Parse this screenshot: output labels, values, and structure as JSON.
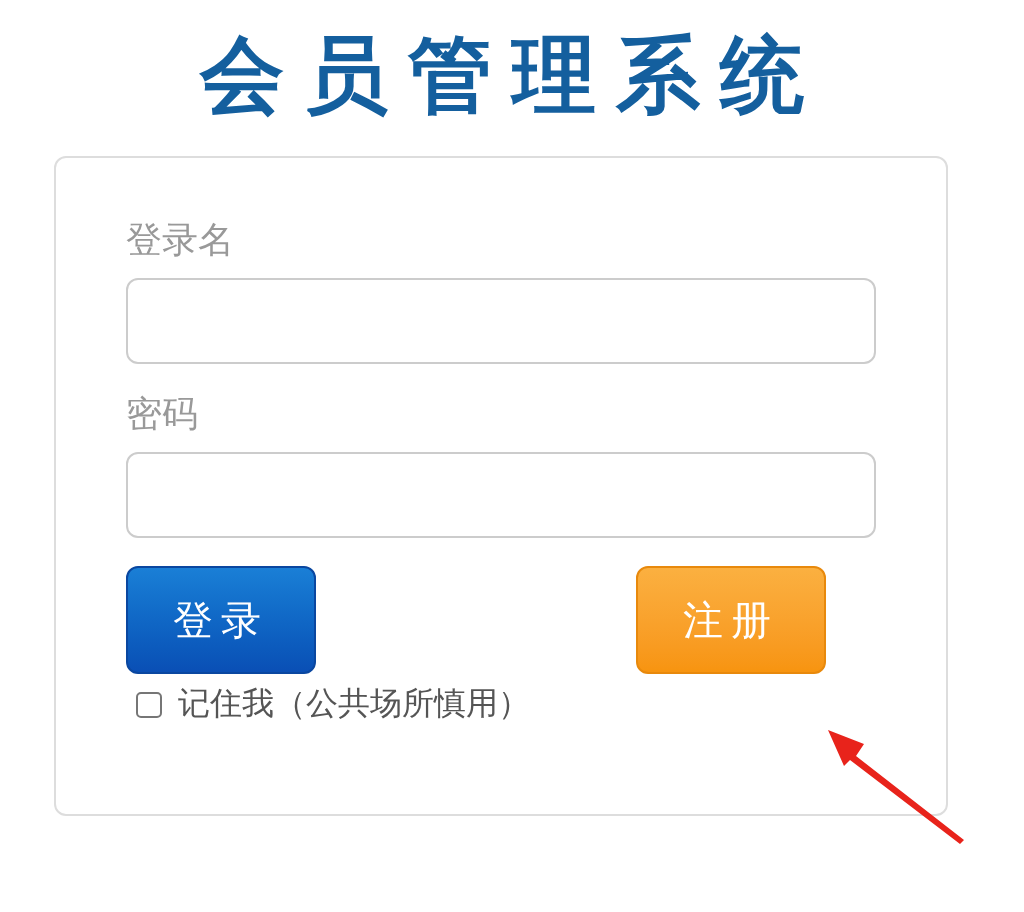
{
  "title": "会员管理系统",
  "fields": [
    {
      "label": "登录名"
    },
    {
      "label": "密码"
    }
  ],
  "buttons": [
    {
      "label": "登录",
      "kind": "primary"
    },
    {
      "label": "注册",
      "kind": "warning"
    }
  ],
  "remember": {
    "label": "记住我（公共场所慎用）",
    "checked": false
  }
}
